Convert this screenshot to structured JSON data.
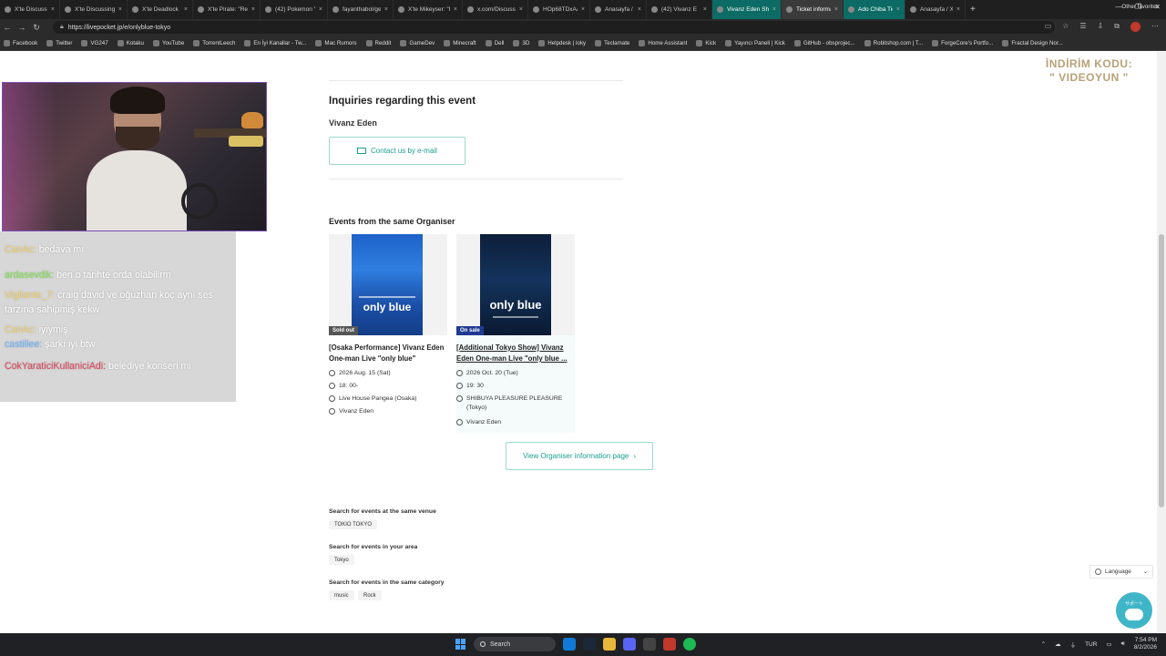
{
  "browser": {
    "tabs": [
      {
        "label": "X'te DiscussingFi",
        "state": "normal"
      },
      {
        "label": "X'te DiscussingFi",
        "state": "normal"
      },
      {
        "label": "X'te Deadlock Inf",
        "state": "normal"
      },
      {
        "label": "X'te Pirate: \"Rem",
        "state": "normal"
      },
      {
        "label": "(42) Pokemon Yel",
        "state": "normal"
      },
      {
        "label": "fayanthabol/gen",
        "state": "normal"
      },
      {
        "label": "X'te Mikeyser: \"I",
        "state": "normal"
      },
      {
        "label": "x.com/Discussing",
        "state": "normal"
      },
      {
        "label": "HOp68TDxAAS",
        "state": "normal"
      },
      {
        "label": "Anasayfa / X",
        "state": "normal"
      },
      {
        "label": "(42) Vivanz E",
        "state": "normal"
      },
      {
        "label": "Vivanz Eden Shib",
        "state": "teal"
      },
      {
        "label": "Ticket informatio",
        "state": "active"
      },
      {
        "label": "Ado Chiba Tickets",
        "state": "teal"
      },
      {
        "label": "Anasayfa / X",
        "state": "normal"
      }
    ],
    "new_tab": "+",
    "window_controls": [
      "—",
      "❐",
      "✕"
    ],
    "url": "https://livepocket.jp/e/onlyblue-tokyo",
    "bookmarks": [
      "Facebook",
      "Twitter",
      "VG247",
      "Kotaku",
      "YouTube",
      "TorrentLeech",
      "En İyi Kanallar - Tw...",
      "Mac Rumors",
      "Reddit",
      "GameDev",
      "Minecraft",
      "Dell",
      "3D",
      "Helpdesk | loky",
      "Teclamate",
      "Home Assistant",
      "Kick",
      "Yayıncı Paneli | Kick",
      "GitHub - obsprojec...",
      "Robitshop.com | T...",
      "ForgeCore's Portfo...",
      "Fractal Design Nor..."
    ],
    "other_favorites": "Other favorites"
  },
  "inquiries": {
    "heading": "Inquiries regarding this event",
    "organiser": "Vivanz Eden",
    "contact_label": "Contact us by e-mail"
  },
  "events": {
    "heading": "Events from the same Organiser",
    "cards": [
      {
        "badge": "Sold out",
        "poster_text": "only blue",
        "title": "[Osaka Performance] Vivanz Eden One-man Live \"only blue\"",
        "date": "2026 Aug. 15 (Sat)",
        "time": "18: 00-",
        "venue": "Live House Pangea (Osaka)",
        "organiser": "Vivanz Eden"
      },
      {
        "badge": "On sale",
        "poster_text": "only blue",
        "title": "[Additional Tokyo Show] Vivanz Eden One-man Live \"only blue ...",
        "date": "2026 Oct. 20 (Tue)",
        "time": "19: 30",
        "venue": "SHIBUYA PLEASURE PLEASURE (Tokyo)",
        "organiser": "Vivanz Eden"
      }
    ],
    "view_organiser": "View Organiser information page"
  },
  "search": {
    "venue_heading": "Search for events at the same venue",
    "venue_chip": "TOKIO TOKYO",
    "area_heading": "Search for events in your area",
    "area_chip": "Tokyo",
    "category_heading": "Search for events in the same category",
    "category_chips": [
      "music",
      "Rock"
    ]
  },
  "language_label": "Language",
  "support_label": "サポート",
  "promo": {
    "line1": "İNDİRİM KODU:",
    "line2": "\" VIDEOYUN \""
  },
  "chat": [
    {
      "user": "CanAc:",
      "user_color": "#f5d36b",
      "text": "bedava mı"
    },
    {
      "user": "ardasevdik:",
      "user_color": "#7ee04a",
      "text": "ben o tarihte orda olabilirm"
    },
    {
      "user": "Vigilante_7:",
      "user_color": "#f5d36b",
      "text": "craig david ve oğuzhan koç aynı ses tarzına sahipmiş kekw"
    },
    {
      "user": "CanAc:",
      "user_color": "#f5d36b",
      "text": "iyiymiş"
    },
    {
      "user": "castillee:",
      "user_color": "#6fb4ff",
      "text": "şarkı iyi btw"
    },
    {
      "user": "CokYaraticiKullaniciAdi:",
      "user_color": "#e0435a",
      "text": "belediye konseri mi"
    }
  ],
  "taskbar": {
    "search": "Search",
    "lang": "TUR",
    "time": "7:54 PM",
    "date": "8/2/2026"
  },
  "colors": {
    "accent": "#1a9e8f",
    "sold_badge": "#555555",
    "onsale_badge": "#1f3a93"
  }
}
